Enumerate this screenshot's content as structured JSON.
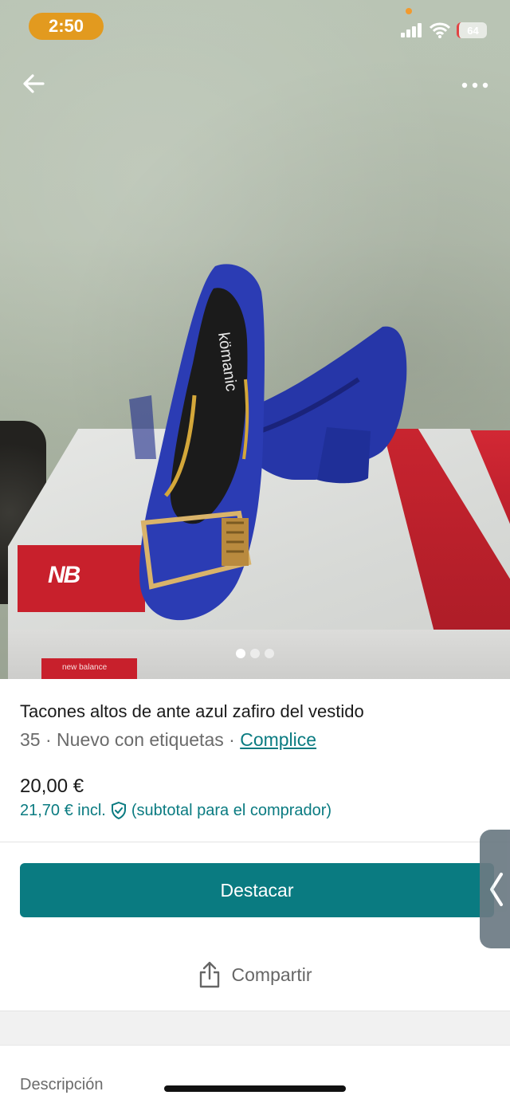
{
  "status_bar": {
    "time": "2:50",
    "battery": "64",
    "icons": [
      "signal-icon",
      "wifi-icon",
      "battery-icon"
    ]
  },
  "nav": {
    "back_icon": "arrow-left-icon",
    "more_icon": "more-dots-icon"
  },
  "photo": {
    "carousel": {
      "total": 3,
      "active_index": 0
    }
  },
  "item": {
    "title": "Tacones altos de ante azul zafiro del vestido",
    "size": "35",
    "separator": "·",
    "condition": "Nuevo con etiquetas",
    "brand": "Complice",
    "price": "20,00 €",
    "price_incl": "21,70 € incl.",
    "buyer_protection_icon": "shield-check-icon",
    "price_incl_note": "(subtotal para el comprador)"
  },
  "actions": {
    "primary_label": "Destacar",
    "share_label": "Compartir",
    "share_icon": "share-icon"
  },
  "section": {
    "description_label": "Descripción"
  },
  "colors": {
    "accent": "#0a7b81",
    "status_time_bg": "#e29a1f",
    "text_primary": "#1a1a1a",
    "text_secondary": "#6b6b6b"
  }
}
